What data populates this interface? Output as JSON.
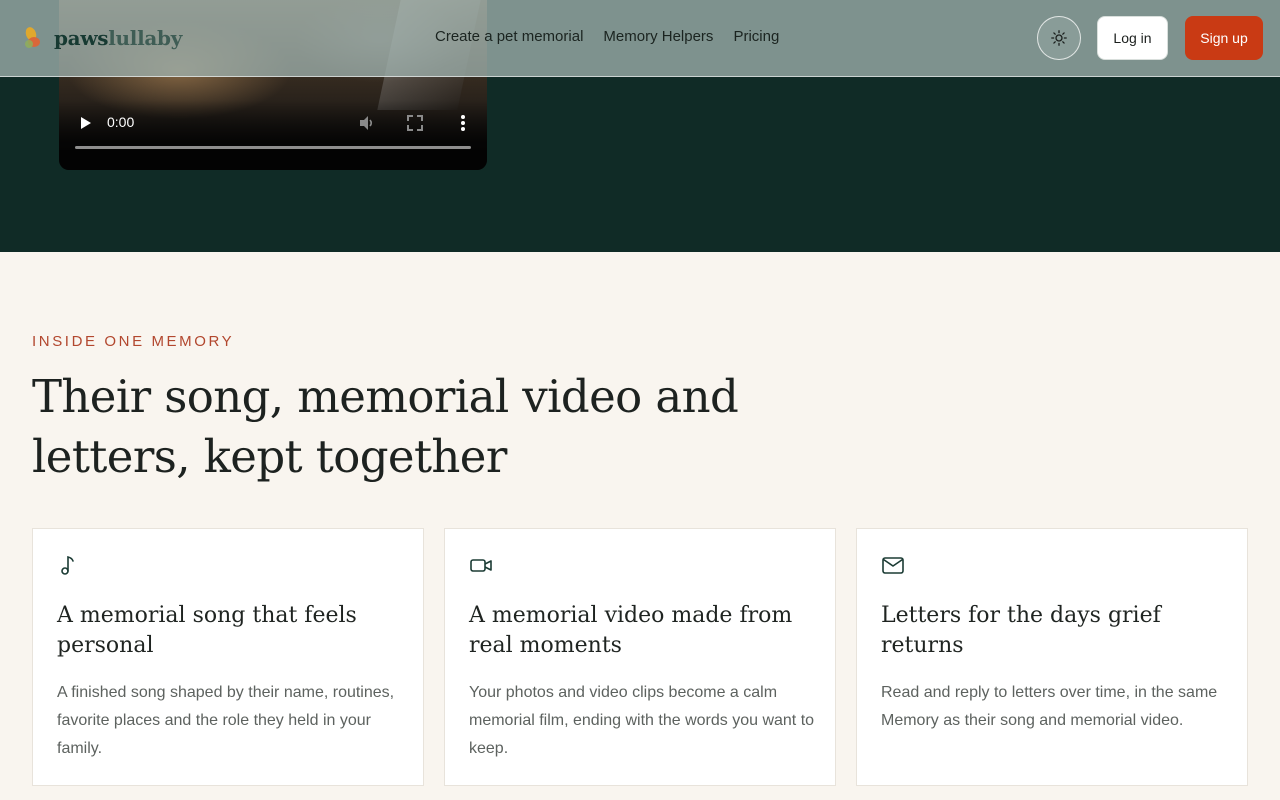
{
  "brand": {
    "name_part1": "paws",
    "name_part2": "lullaby",
    "accent": "#c93a14",
    "dark": "#102b26"
  },
  "nav": {
    "items": [
      {
        "label": "Create a pet memorial"
      },
      {
        "label": "Memory Helpers"
      },
      {
        "label": "Pricing"
      }
    ]
  },
  "header_actions": {
    "theme_icon": "sun-icon",
    "login_label": "Log in",
    "signup_label": "Sign up"
  },
  "video": {
    "time": "0:00",
    "progress": 0,
    "icons": [
      "play-icon",
      "volume-icon",
      "fullscreen-icon",
      "more-vertical-icon"
    ]
  },
  "section": {
    "eyebrow": "INSIDE ONE MEMORY",
    "headline": "Their song, memorial video and letters, kept together"
  },
  "cards": [
    {
      "icon": "music-note-icon",
      "title": "A memorial song that feels personal",
      "body": "A finished song shaped by their name, routines, favorite places and the role they held in your family."
    },
    {
      "icon": "video-camera-icon",
      "title": "A memorial video made from real moments",
      "body": "Your photos and video clips become a calm memorial film, ending with the words you want to keep."
    },
    {
      "icon": "envelope-icon",
      "title": "Letters for the days grief returns",
      "body": "Read and reply to letters over time, in the same Memory as their song and memorial video."
    }
  ]
}
